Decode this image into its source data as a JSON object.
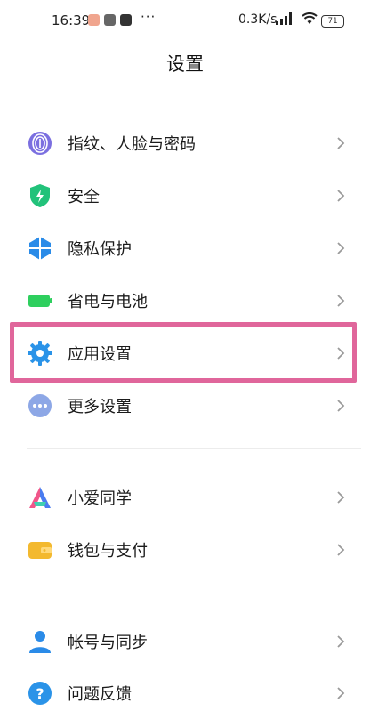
{
  "status_bar": {
    "time": "16:39",
    "dots": "···",
    "net_speed": "0.3K/s",
    "battery": "71"
  },
  "header": {
    "title": "设置"
  },
  "groups": [
    {
      "items": [
        {
          "label": "指纹、人脸与密码",
          "icon": "fingerprint-icon",
          "color": "#7b6fe0"
        },
        {
          "label": "安全",
          "icon": "shield-icon",
          "color": "#22c27a"
        },
        {
          "label": "隐私保护",
          "icon": "privacy-icon",
          "color": "#2a8be8"
        },
        {
          "label": "省电与电池",
          "icon": "battery-icon",
          "color": "#2ecf5e"
        },
        {
          "label": "应用设置",
          "icon": "gear-icon",
          "color": "#2a93e8"
        },
        {
          "label": "更多设置",
          "icon": "more-icon",
          "color": "#8da7e6"
        }
      ]
    },
    {
      "items": [
        {
          "label": "小爱同学",
          "icon": "xiaoai-icon",
          "color": "#4a7cf0"
        },
        {
          "label": "钱包与支付",
          "icon": "wallet-icon",
          "color": "#f3b92f"
        }
      ]
    },
    {
      "items": [
        {
          "label": "帐号与同步",
          "icon": "account-icon",
          "color": "#2a8be8"
        },
        {
          "label": "问题反馈",
          "icon": "feedback-icon",
          "color": "#2a93e8"
        }
      ]
    }
  ],
  "highlight": {
    "target": "应用设置",
    "color": "#e0669b"
  }
}
